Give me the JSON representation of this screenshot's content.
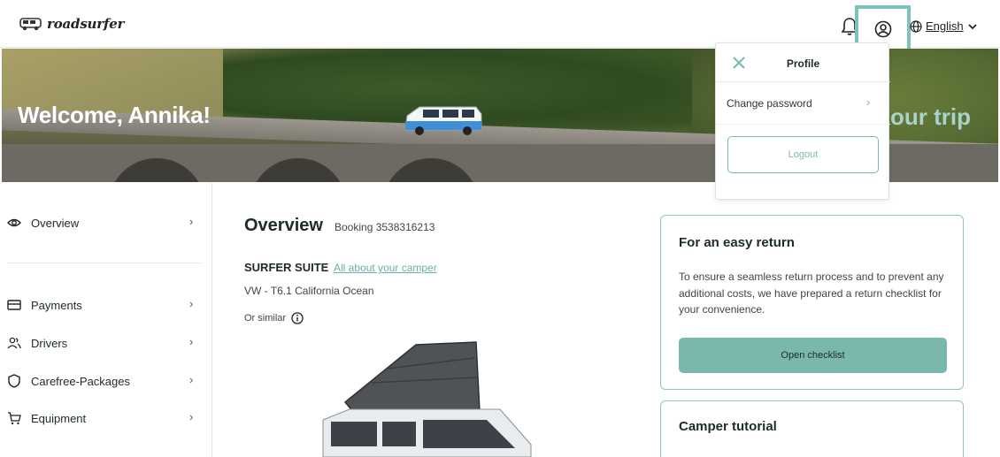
{
  "header": {
    "logo_text": "roadsurfer",
    "language": "English"
  },
  "hero": {
    "welcome": "Welcome, Annika!",
    "right_text": "our trip"
  },
  "sidebar": {
    "items": [
      {
        "label": "Overview",
        "icon": "eye-icon"
      },
      {
        "label": "Payments",
        "icon": "card-icon"
      },
      {
        "label": "Drivers",
        "icon": "users-icon"
      },
      {
        "label": "Carefree-Packages",
        "icon": "shield-icon"
      },
      {
        "label": "Equipment",
        "icon": "cart-icon"
      }
    ]
  },
  "main": {
    "title": "Overview",
    "booking": "Booking 3538316213",
    "camper_name": "SURFER SUITE",
    "camper_link": "All about your camper",
    "camper_model": "VW - T6.1 California Ocean",
    "or_similar": "Or similar"
  },
  "cards": {
    "return": {
      "title": "For an easy return",
      "text": "To ensure a seamless return process and to prevent any additional costs, we have prepared a return checklist for your convenience.",
      "button": "Open checklist"
    },
    "tutorial": {
      "title": "Camper tutorial"
    }
  },
  "profile_dropdown": {
    "title": "Profile",
    "change_password": "Change password",
    "logout": "Logout"
  },
  "colors": {
    "accent": "#7ab8ae",
    "highlight_border": "#7cc3bd"
  }
}
